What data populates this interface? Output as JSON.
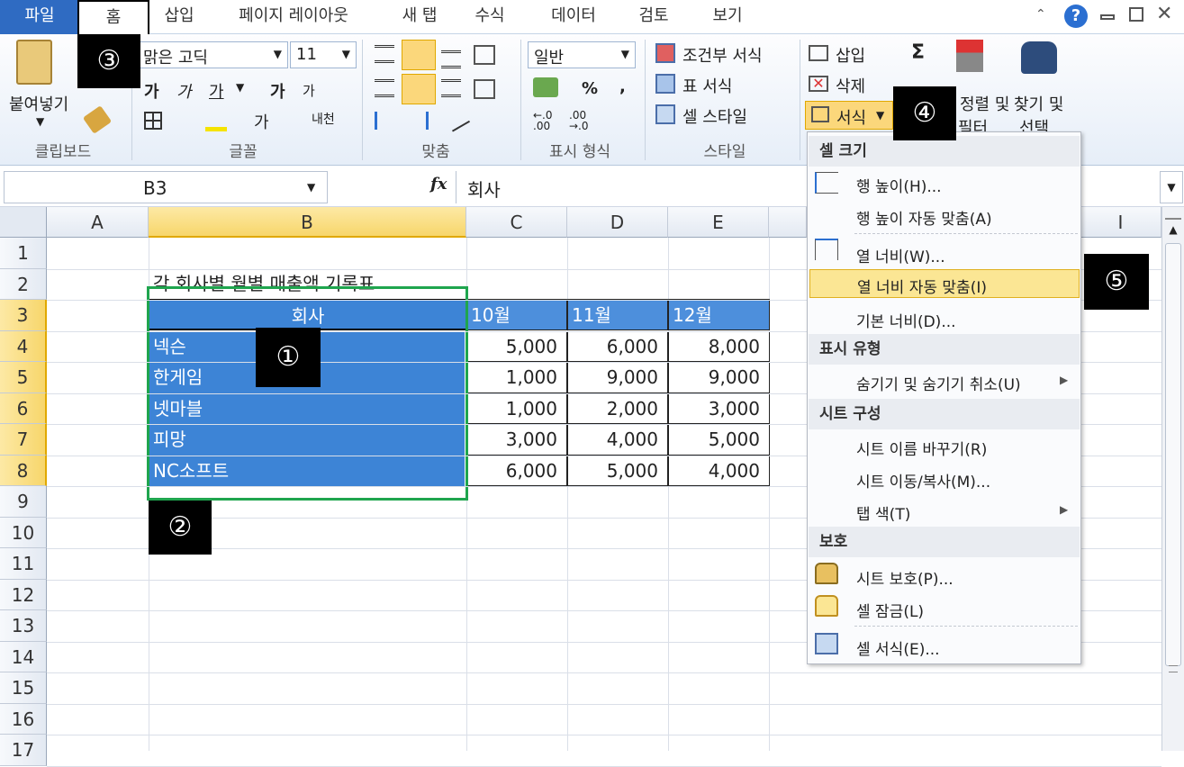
{
  "tabs": [
    "파일",
    "홈",
    "삽입",
    "페이지 레이아웃",
    "새 탭",
    "수식",
    "데이터",
    "검토",
    "보기"
  ],
  "ribbon": {
    "clipboard": {
      "paste": "붙여넣기",
      "label": "클립보드"
    },
    "font": {
      "name": "맑은 고딕",
      "size": "11",
      "bold": "가",
      "italic": "가",
      "underline": "가",
      "grow": "가",
      "shrink": "가",
      "label": "글꼴",
      "phonetic": "내천"
    },
    "align": {
      "label": "맞춤"
    },
    "number": {
      "format": "일반",
      "percent": "%",
      "comma": ",",
      "label": "표시 형식",
      "inc": "←.0 .00",
      "dec": ".00 →.0"
    },
    "styles": {
      "cond": "조건부 서식",
      "table": "표 서식",
      "cell": "셀 스타일",
      "label": "스타일"
    },
    "cells": {
      "insert": "삽입",
      "delete": "삭제",
      "format": "서식"
    },
    "editing": {
      "sigma": "Σ",
      "sort": "정렬 및",
      "filter": "필터",
      "find": "찾기 및",
      "select": "선택"
    }
  },
  "formula_bar": {
    "name_box": "B3",
    "fx": "fx",
    "value": "회사"
  },
  "sheet": {
    "columns": [
      "A",
      "B",
      "C",
      "D",
      "E",
      "I"
    ],
    "rows": [
      "1",
      "2",
      "3",
      "4",
      "5",
      "6",
      "7",
      "8",
      "9",
      "10",
      "11",
      "12",
      "13",
      "14",
      "15",
      "16",
      "17"
    ],
    "title": "각 회사별 월별 매출액 기록표",
    "header": [
      "회사",
      "10월",
      "11월",
      "12월"
    ],
    "data": [
      [
        "넥슨",
        "5,000",
        "6,000",
        "8,000"
      ],
      [
        "한게임",
        "1,000",
        "9,000",
        "9,000"
      ],
      [
        "넷마블",
        "1,000",
        "2,000",
        "3,000"
      ],
      [
        "피망",
        "3,000",
        "4,000",
        "5,000"
      ],
      [
        "NC소프트",
        "6,000",
        "5,000",
        "4,000"
      ]
    ]
  },
  "menu": {
    "h1": "셀 크기",
    "row_height": "행 높이(H)...",
    "row_autofit": "행 높이 자동 맞춤(A)",
    "col_width": "열 너비(W)...",
    "col_autofit": "열 너비 자동 맞춤(I)",
    "default_width": "기본 너비(D)...",
    "h2": "표시 유형",
    "hide": "숨기기 및 숨기기 취소(U)",
    "h3": "시트 구성",
    "rename": "시트 이름 바꾸기(R)",
    "move": "시트 이동/복사(M)...",
    "tab_color": "탭 색(T)",
    "h4": "보호",
    "protect": "시트 보호(P)...",
    "lock": "셀 잠금(L)",
    "format_cells": "셀 서식(E)..."
  },
  "badges": [
    "①",
    "②",
    "③",
    "④",
    "⑤"
  ],
  "colors": {
    "accent": "#3d84d6",
    "file_tab": "#2f6bc2",
    "highlight": "#fbe694",
    "green": "#1fa54e"
  }
}
